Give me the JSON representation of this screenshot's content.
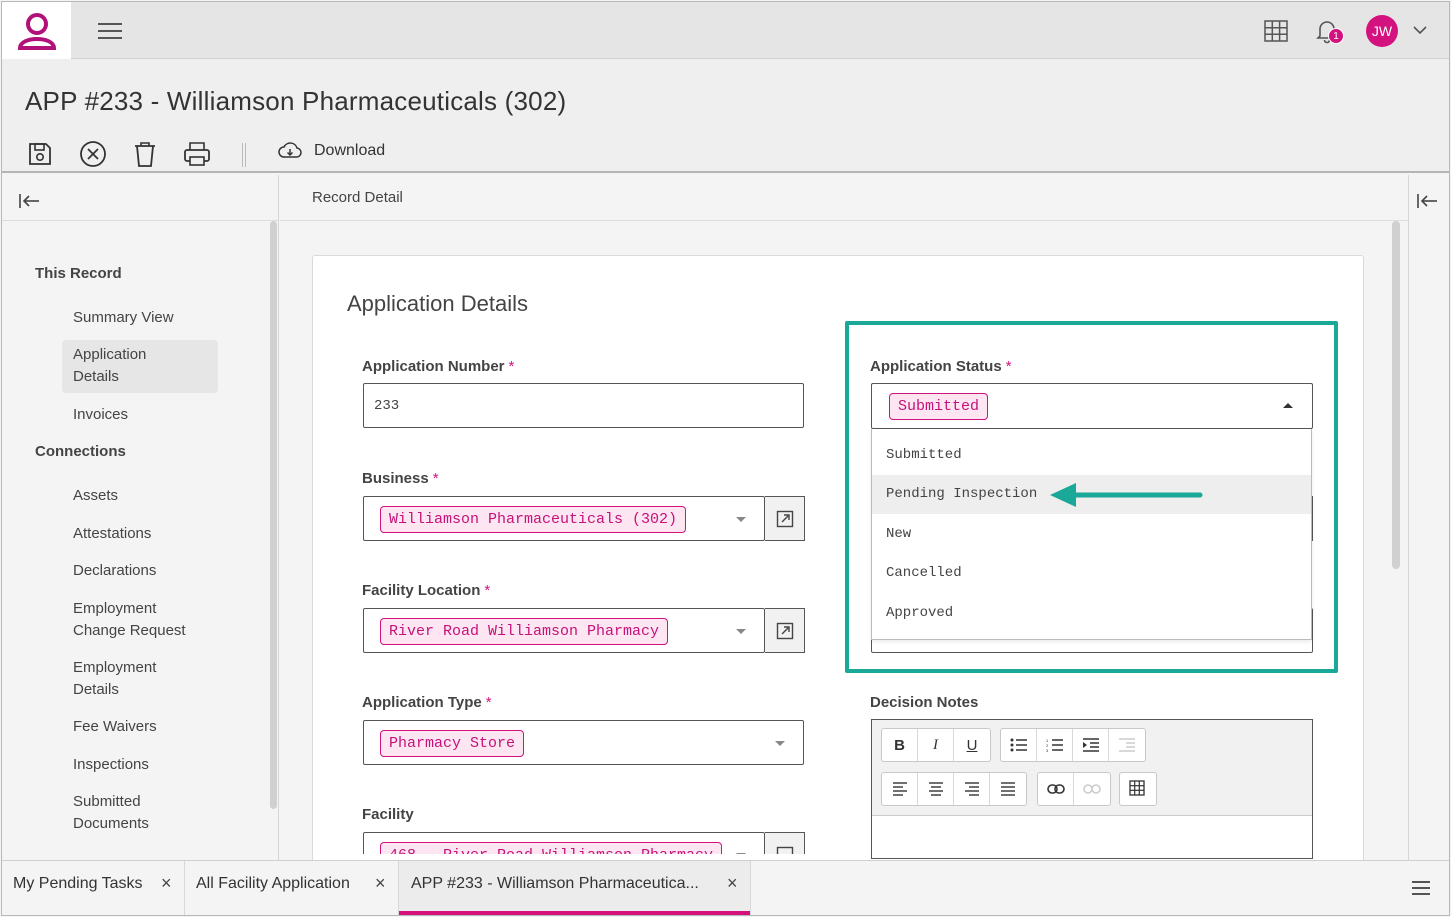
{
  "header": {
    "notification_count": "1",
    "user_initials": "JW",
    "brand_color": "#d3127f"
  },
  "page": {
    "title": "APP #233 - Williamson Pharmaceuticals (302)",
    "download_label": "Download",
    "record_title": "Record Detail"
  },
  "sidebar": {
    "section1": "This Record",
    "section1_items": [
      "Summary View",
      "Application Details",
      "Invoices"
    ],
    "section2": "Connections",
    "section2_items": [
      "Assets",
      "Attestations",
      "Declarations",
      "Employment Change Request",
      "Employment Details",
      "Fee Waivers",
      "Inspections",
      "Submitted Documents"
    ],
    "selected": "Application Details"
  },
  "form": {
    "title": "Application Details",
    "app_number": {
      "label": "Application Number",
      "value": "233"
    },
    "business": {
      "label": "Business",
      "value": "Williamson Pharmaceuticals (302)"
    },
    "facility_location": {
      "label": "Facility Location",
      "value": "River Road Williamson Pharmacy"
    },
    "application_type": {
      "label": "Application Type",
      "value": "Pharmacy Store"
    },
    "facility": {
      "label": "Facility",
      "value": "468 - River Road Williamson Pharmacy"
    },
    "status": {
      "label": "Application Status",
      "value": "Submitted",
      "options": [
        "Submitted",
        "Pending Inspection",
        "New",
        "Cancelled",
        "Approved"
      ],
      "highlighted": "Pending Inspection"
    },
    "decision_notes": {
      "label": "Decision Notes"
    },
    "required_mark": "*"
  },
  "editor": {
    "bold": "B",
    "italic": "I",
    "underline": "U"
  },
  "tabs": [
    {
      "label": "My Pending Tasks",
      "close": "×"
    },
    {
      "label": "All Facility Application",
      "close": "×"
    },
    {
      "label": "APP #233 - Williamson Pharmaceutica...",
      "close": "×"
    }
  ],
  "colors": {
    "accent": "#d3127f",
    "highlight": "#1aa898"
  }
}
